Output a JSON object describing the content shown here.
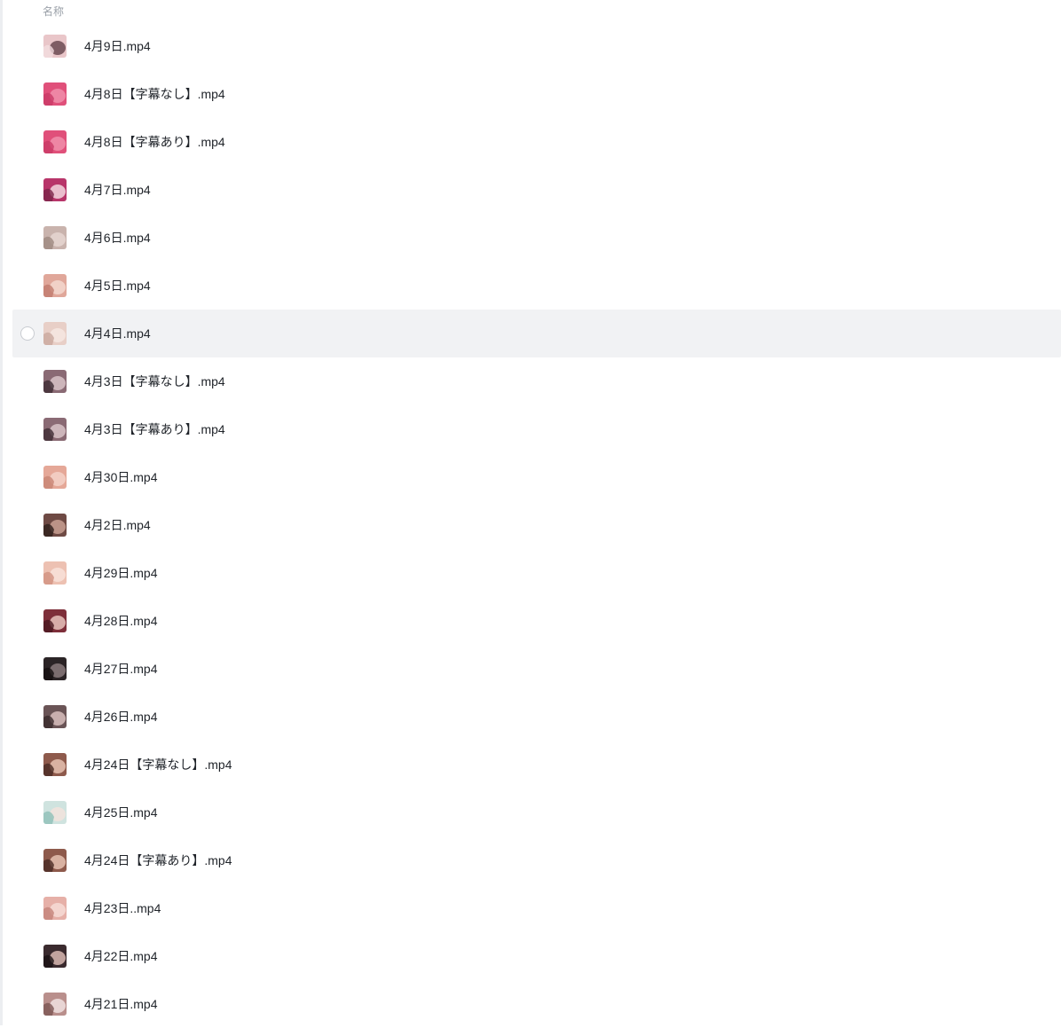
{
  "header": {
    "name_column": "名称"
  },
  "files": [
    {
      "name": "4月9日.mp4",
      "thumb": {
        "bg": "#e9c6c9",
        "a": "#6b4a52",
        "b": "#f3dde0"
      }
    },
    {
      "name": "4月8日【字幕なし】.mp4",
      "thumb": {
        "bg": "#e0507a",
        "a": "#f08fab",
        "b": "#c93a66"
      }
    },
    {
      "name": "4月8日【字幕あり】.mp4",
      "thumb": {
        "bg": "#e0507a",
        "a": "#f08fab",
        "b": "#c93a66"
      }
    },
    {
      "name": "4月7日.mp4",
      "thumb": {
        "bg": "#b8356a",
        "a": "#f2d6de",
        "b": "#7a2448"
      }
    },
    {
      "name": "4月6日.mp4",
      "thumb": {
        "bg": "#c9b3ad",
        "a": "#e6d6d1",
        "b": "#9d8880"
      }
    },
    {
      "name": "4月5日.mp4",
      "thumb": {
        "bg": "#e0a79a",
        "a": "#f3d8cf",
        "b": "#c07a6d"
      }
    },
    {
      "name": "4月4日.mp4",
      "thumb": {
        "bg": "#e8cfc7",
        "a": "#f6e7e2",
        "b": "#c9a89d"
      }
    },
    {
      "name": "4月3日【字幕なし】.mp4",
      "thumb": {
        "bg": "#8a6a74",
        "a": "#d8c3c8",
        "b": "#3d2c33"
      }
    },
    {
      "name": "4月3日【字幕あり】.mp4",
      "thumb": {
        "bg": "#8a6a74",
        "a": "#d8c3c8",
        "b": "#3d2c33"
      }
    },
    {
      "name": "4月30日.mp4",
      "thumb": {
        "bg": "#e5a898",
        "a": "#f4d2c8",
        "b": "#c88474"
      }
    },
    {
      "name": "4月2日.mp4",
      "thumb": {
        "bg": "#6e4a44",
        "a": "#c9a093",
        "b": "#2e1f1c"
      }
    },
    {
      "name": "4月29日.mp4",
      "thumb": {
        "bg": "#edc1b2",
        "a": "#f8e2d9",
        "b": "#d1917f"
      }
    },
    {
      "name": "4月28日.mp4",
      "thumb": {
        "bg": "#7e2f3a",
        "a": "#e8c3bd",
        "b": "#4a1820"
      }
    },
    {
      "name": "4月27日.mp4",
      "thumb": {
        "bg": "#2b2426",
        "a": "#8a7a7c",
        "b": "#150f10"
      }
    },
    {
      "name": "4月26日.mp4",
      "thumb": {
        "bg": "#6a5456",
        "a": "#d8c0bd",
        "b": "#3a2a2c"
      }
    },
    {
      "name": "4月24日【字幕なし】.mp4",
      "thumb": {
        "bg": "#8e5a4c",
        "a": "#e6c2b2",
        "b": "#4a2b24"
      }
    },
    {
      "name": "4月25日.mp4",
      "thumb": {
        "bg": "#cfe3df",
        "a": "#f2e3dd",
        "b": "#8fbfb8"
      }
    },
    {
      "name": "4月24日【字幕あり】.mp4",
      "thumb": {
        "bg": "#8e5a4c",
        "a": "#e6c2b2",
        "b": "#4a2b24"
      }
    },
    {
      "name": "4月23日..mp4",
      "thumb": {
        "bg": "#e6b0a8",
        "a": "#f6dcd6",
        "b": "#c48379"
      }
    },
    {
      "name": "4月22日.mp4",
      "thumb": {
        "bg": "#3a2a2e",
        "a": "#d9b8b2",
        "b": "#1a1214"
      }
    },
    {
      "name": "4月21日.mp4",
      "thumb": {
        "bg": "#b98f8c",
        "a": "#f0e2e0",
        "b": "#7c5553"
      }
    }
  ],
  "hovered_row_index": 6
}
